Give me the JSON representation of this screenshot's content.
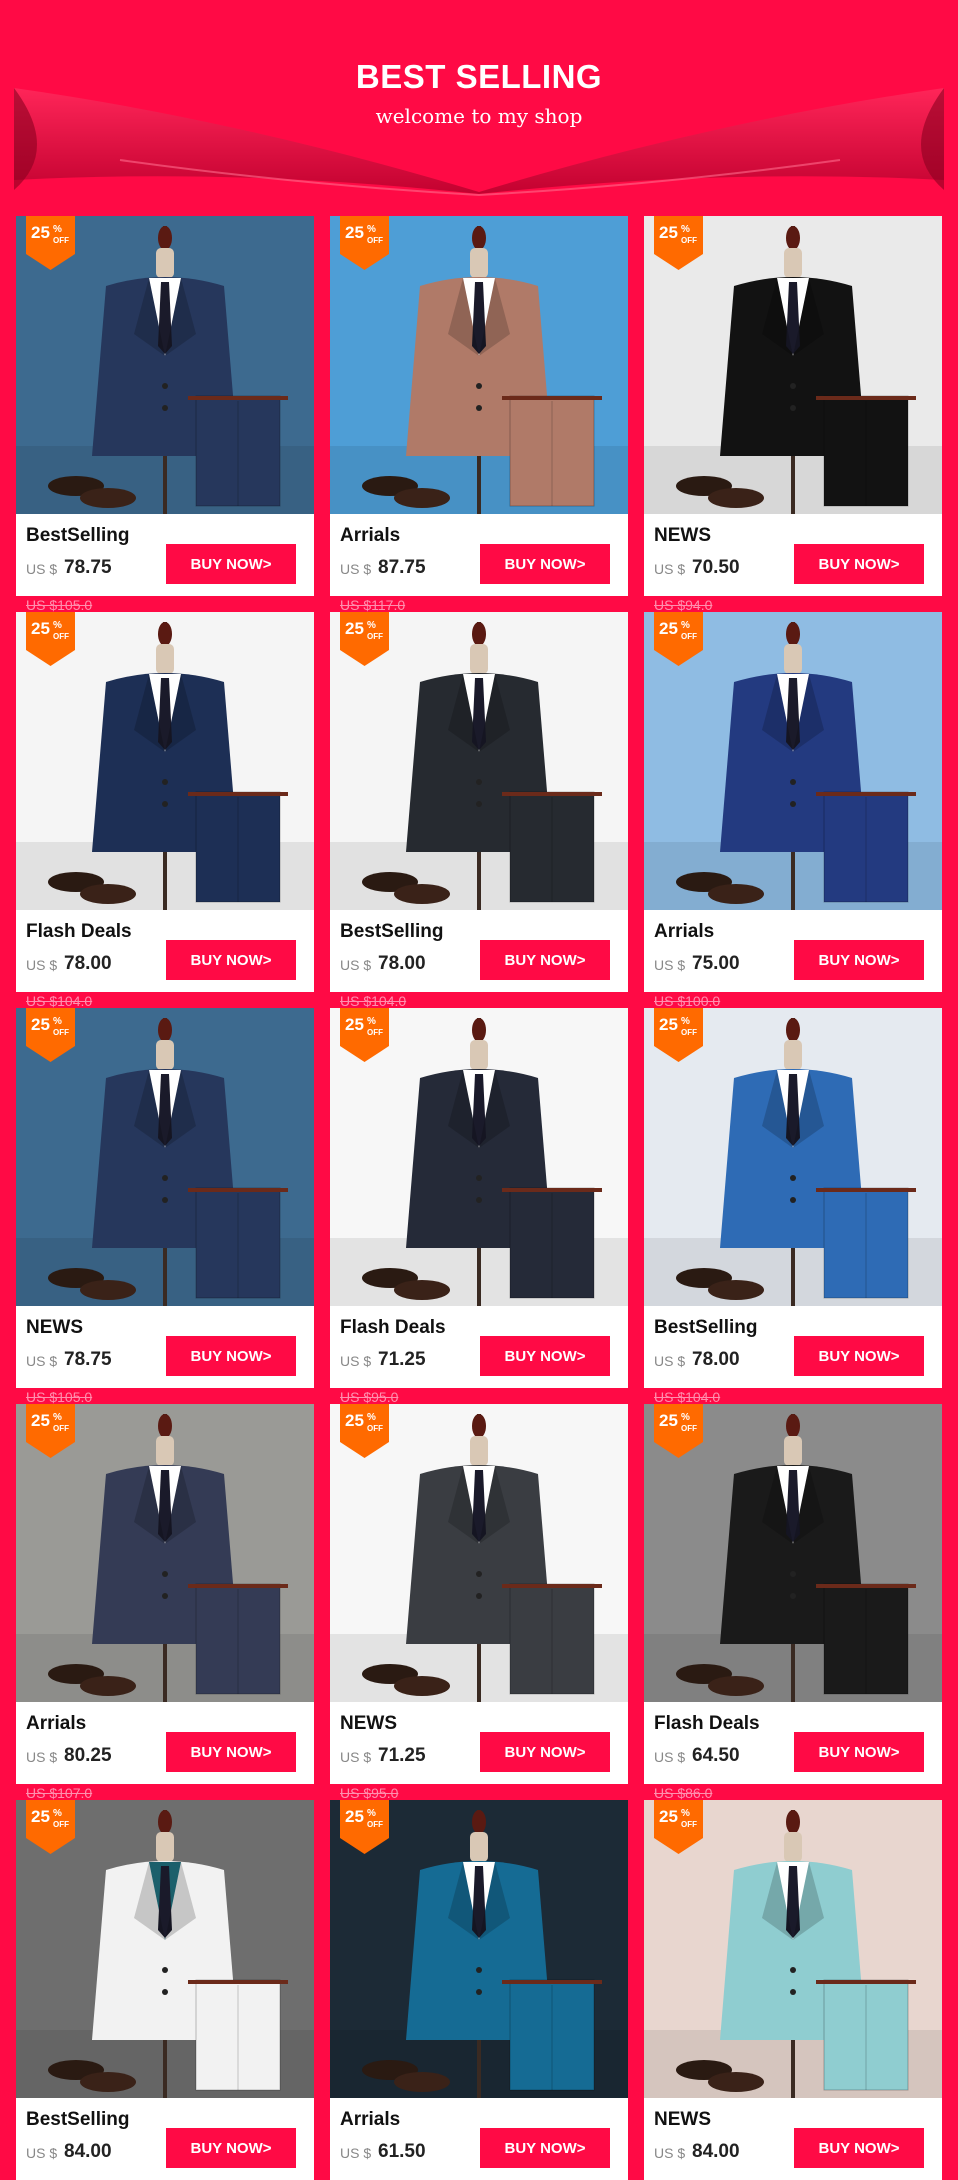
{
  "colors": {
    "brand": "#ff0a45",
    "badge": "#ff6a00",
    "button": "#ff0a45"
  },
  "banner": {
    "title": "BEST SELLING",
    "subtitle": "welcome to my shop"
  },
  "badge": {
    "discount": "25",
    "percent": "%",
    "off": "OFF"
  },
  "currency": "US $",
  "buy_label": "BUY NOW>",
  "products": [
    {
      "title": "BestSelling",
      "price": "78.75",
      "old_price": "US $105.0",
      "suit_color": "#26375c",
      "bg": "#3d6a8f",
      "shirt": "#ffffff"
    },
    {
      "title": "Arrials",
      "price": "87.75",
      "old_price": "US $117.0",
      "suit_color": "#b07a68",
      "bg": "#4e9ed6",
      "shirt": "#ffffff"
    },
    {
      "title": "NEWS",
      "price": "70.50",
      "old_price": "US $94.0",
      "suit_color": "#121212",
      "bg": "#eaeaea",
      "shirt": "#ffffff"
    },
    {
      "title": "Flash Deals",
      "price": "78.00",
      "old_price": "US $104.0",
      "suit_color": "#1d2f55",
      "bg": "#f5f5f5",
      "shirt": "#ffffff"
    },
    {
      "title": "BestSelling",
      "price": "78.00",
      "old_price": "US $104.0",
      "suit_color": "#262a30",
      "bg": "#f5f5f5",
      "shirt": "#ffffff"
    },
    {
      "title": "Arrials",
      "price": "75.00",
      "old_price": "US $100.0",
      "suit_color": "#233a80",
      "bg": "#8fbce3",
      "shirt": "#ffffff"
    },
    {
      "title": "NEWS",
      "price": "78.75",
      "old_price": "US $105.0",
      "suit_color": "#26375c",
      "bg": "#3d6a8f",
      "shirt": "#ffffff"
    },
    {
      "title": "Flash Deals",
      "price": "71.25",
      "old_price": "US $95.0",
      "suit_color": "#252a38",
      "bg": "#f7f7f7",
      "shirt": "#ffffff"
    },
    {
      "title": "BestSelling",
      "price": "78.00",
      "old_price": "US $104.0",
      "suit_color": "#2e6bb5",
      "bg": "#e5eaf0",
      "shirt": "#ffffff"
    },
    {
      "title": "Arrials",
      "price": "80.25",
      "old_price": "US $107.0",
      "suit_color": "#343b55",
      "bg": "#9a9a96",
      "shirt": "#ffffff"
    },
    {
      "title": "NEWS",
      "price": "71.25",
      "old_price": "US $95.0",
      "suit_color": "#3a3d42",
      "bg": "#f7f7f7",
      "shirt": "#ffffff"
    },
    {
      "title": "Flash Deals",
      "price": "64.50",
      "old_price": "US $86.0",
      "suit_color": "#1a1a1a",
      "bg": "#8b8b8b",
      "shirt": "#ffffff"
    },
    {
      "title": "BestSelling",
      "price": "84.00",
      "old_price": "",
      "suit_color": "#f2f2f2",
      "bg": "#6e6e6e",
      "shirt": "#1b5f6b"
    },
    {
      "title": "Arrials",
      "price": "61.50",
      "old_price": "",
      "suit_color": "#156b94",
      "bg": "#1c2a36",
      "shirt": "#ffffff"
    },
    {
      "title": "NEWS",
      "price": "84.00",
      "old_price": "",
      "suit_color": "#8fcdd0",
      "bg": "#e8d6cf",
      "shirt": "#ffffff"
    }
  ]
}
